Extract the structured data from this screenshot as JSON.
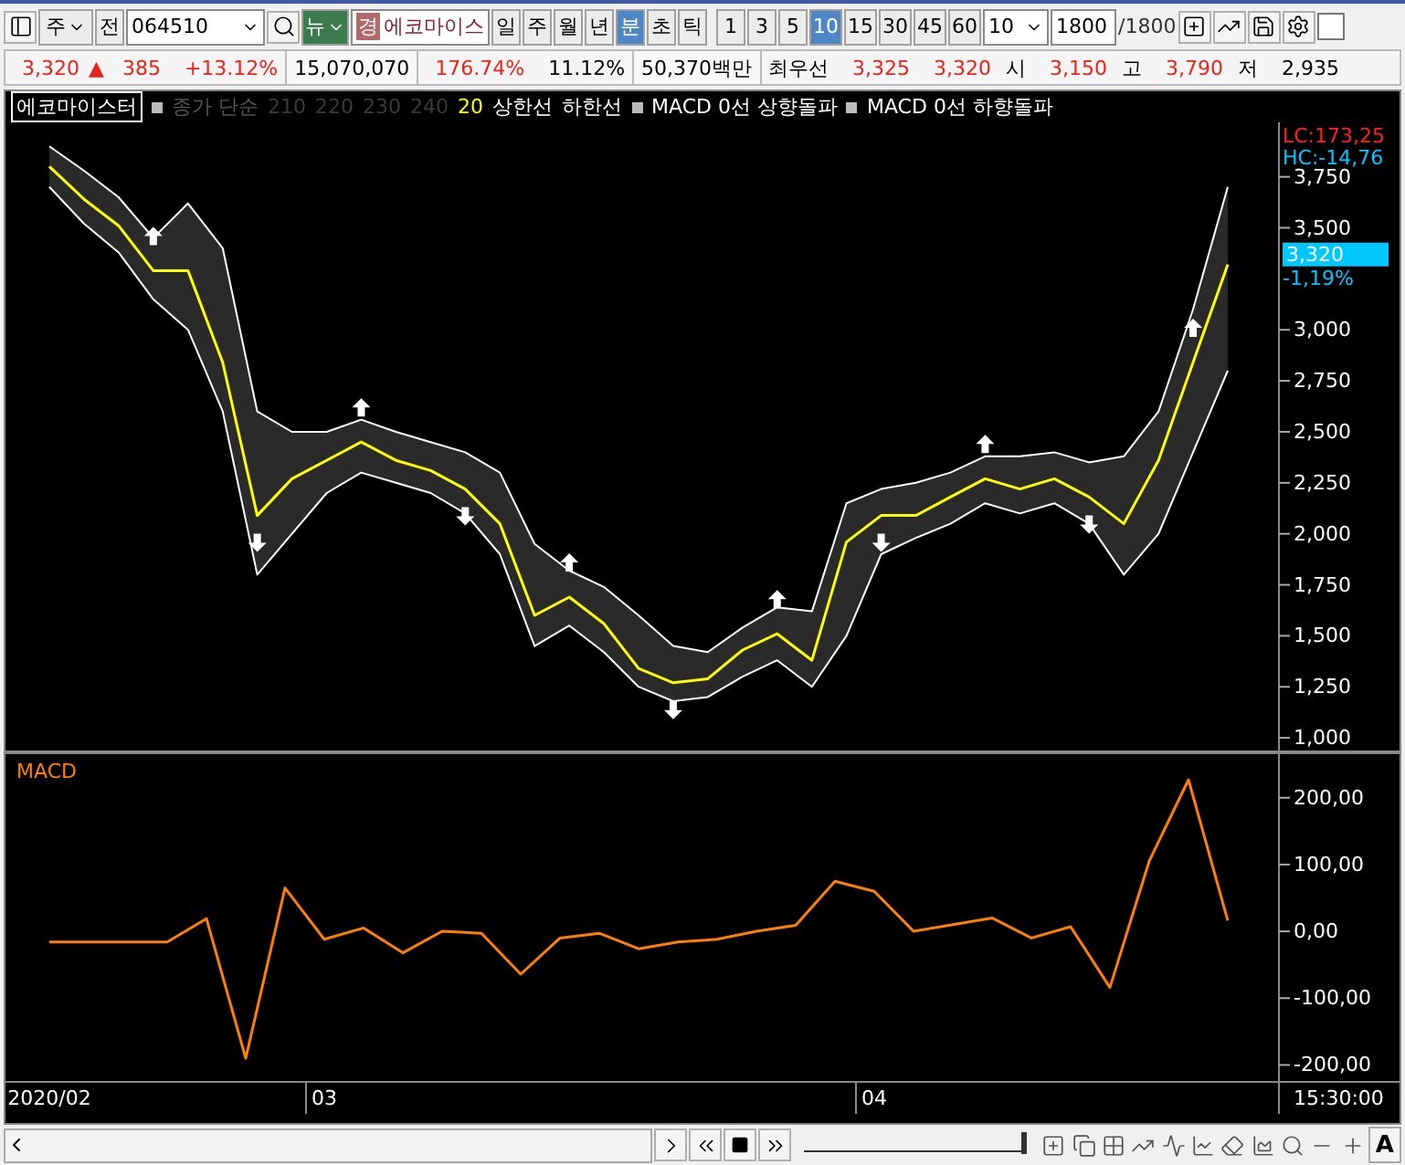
{
  "toolbar": {
    "market": "주",
    "prev": "전",
    "code": "064510",
    "news": "뉴",
    "name_badge": "경",
    "name": "에코마이스",
    "periods": [
      {
        "label": "일",
        "selected": false
      },
      {
        "label": "주",
        "selected": false
      },
      {
        "label": "월",
        "selected": false
      },
      {
        "label": "년",
        "selected": false
      },
      {
        "label": "분",
        "selected": true
      },
      {
        "label": "초",
        "selected": false
      },
      {
        "label": "틱",
        "selected": false
      }
    ],
    "minutes": [
      {
        "label": "1",
        "selected": false
      },
      {
        "label": "3",
        "selected": false
      },
      {
        "label": "5",
        "selected": false
      },
      {
        "label": "10",
        "selected": true
      },
      {
        "label": "15",
        "selected": false
      },
      {
        "label": "30",
        "selected": false
      },
      {
        "label": "45",
        "selected": false
      },
      {
        "label": "60",
        "selected": false
      }
    ],
    "interval": "10",
    "count": "1800",
    "count_total": "/1800",
    "overlay_checked": false
  },
  "quote": {
    "cells": [
      {
        "text": "3,320",
        "color": "#e8231b",
        "kind": "value"
      },
      {
        "text": "▲",
        "color": "#e8231b",
        "kind": "sign"
      },
      {
        "text": "385",
        "color": "#e8231b",
        "kind": "value"
      },
      {
        "text": "+13.12%",
        "color": "#e8231b",
        "kind": "value"
      },
      {
        "text": "15,070,070",
        "color": "#000000",
        "kind": "boxed"
      },
      {
        "text": "176.74%",
        "color": "#e8231b",
        "kind": "value"
      },
      {
        "text": "11.12%",
        "color": "#000000",
        "kind": "value"
      },
      {
        "text": "50,370백만",
        "color": "#000000",
        "kind": "boxed"
      },
      {
        "text": "최우선",
        "color": "#000000",
        "kind": "label"
      },
      {
        "text": "3,325",
        "color": "#e8231b",
        "kind": "value"
      },
      {
        "text": "3,320",
        "color": "#e8231b",
        "kind": "value"
      },
      {
        "text": "시",
        "color": "#000000",
        "kind": "label"
      },
      {
        "text": "3,150",
        "color": "#e8231b",
        "kind": "value"
      },
      {
        "text": "고",
        "color": "#000000",
        "kind": "label"
      },
      {
        "text": "3,790",
        "color": "#e8231b",
        "kind": "value"
      },
      {
        "text": "저",
        "color": "#000000",
        "kind": "label"
      },
      {
        "text": "2,935",
        "color": "#000000",
        "kind": "value"
      }
    ]
  },
  "legend": [
    {
      "text": "에코마이스터",
      "kind": "title"
    },
    {
      "text": "종가 단순",
      "kind": "marker",
      "enabled": false
    },
    {
      "text": "210",
      "kind": "param",
      "color": "#3a3a3a"
    },
    {
      "text": "220",
      "kind": "param",
      "color": "#3a3a3a"
    },
    {
      "text": "230",
      "kind": "param",
      "color": "#3a3a3a"
    },
    {
      "text": "240",
      "kind": "param",
      "color": "#3a3a3a"
    },
    {
      "text": "20",
      "kind": "param",
      "color": "#ffff00"
    }
  ],
  "signals": [
    {
      "text": "MACD 0선 상향돌파",
      "enabled": true
    },
    {
      "text": "MACD 0선 하향돌파",
      "enabled": true
    }
  ],
  "price_pane": {
    "lc": "LC:173,25",
    "hc": "HC:-14,76",
    "last_price": "3,320",
    "last_change": "-1,19%",
    "chart_data": {
      "type": "line",
      "ylim": [
        929,
        4017
      ],
      "categories": [
        null,
        null,
        null,
        null,
        null,
        null,
        null,
        null,
        null,
        null,
        null,
        null,
        null,
        null,
        null,
        null,
        null,
        null,
        null,
        null,
        null,
        null,
        null,
        null,
        null,
        null,
        null,
        null,
        null,
        null,
        null,
        null,
        null,
        null,
        null
      ],
      "yticks": [
        {
          "value": 3750,
          "label": "3,750"
        },
        {
          "value": 3500,
          "label": "3,500"
        },
        {
          "value": 3000,
          "label": "3,000"
        },
        {
          "value": 2750,
          "label": "2,750"
        },
        {
          "value": 2500,
          "label": "2,500"
        },
        {
          "value": 2250,
          "label": "2,250"
        },
        {
          "value": 2000,
          "label": "2,000"
        },
        {
          "value": 1750,
          "label": "1,750"
        },
        {
          "value": 1500,
          "label": "1,500"
        },
        {
          "value": 1250,
          "label": "1,250"
        },
        {
          "value": 1000,
          "label": "1,000"
        }
      ],
      "series": [
        {
          "color": "#ffff00",
          "values": [
            3800,
            3640,
            3510,
            3290,
            3290,
            2840,
            2090,
            2270,
            2360,
            2450,
            2360,
            2310,
            2220,
            2050,
            1600,
            1690,
            1560,
            1340,
            1270,
            1290,
            1430,
            1510,
            1380,
            1960,
            2090,
            2090,
            2180,
            2270,
            2220,
            2270,
            2180,
            2050,
            2360,
            2840,
            3320
          ]
        },
        {
          "name": "상한선",
          "color": "#ffffff",
          "values": [
            3900,
            3780,
            3650,
            3450,
            3620,
            3400,
            2600,
            2500,
            2500,
            2560,
            2500,
            2450,
            2400,
            2300,
            1950,
            1820,
            1740,
            1600,
            1450,
            1420,
            1540,
            1640,
            1620,
            2150,
            2220,
            2250,
            2300,
            2380,
            2380,
            2400,
            2350,
            2380,
            2600,
            3100,
            3700
          ]
        },
        {
          "name": "하한선",
          "color": "#ffffff",
          "values": [
            3700,
            3520,
            3380,
            3150,
            3000,
            2600,
            1800,
            2000,
            2200,
            2300,
            2250,
            2200,
            2100,
            1900,
            1450,
            1550,
            1420,
            1250,
            1180,
            1200,
            1300,
            1380,
            1250,
            1500,
            1900,
            1980,
            2050,
            2150,
            2100,
            2150,
            2050,
            1800,
            2000,
            2400,
            2800
          ]
        }
      ]
    }
  },
  "macd_pane": {
    "chart_data": {
      "type": "line",
      "ylim": [
        -224,
        268
      ],
      "categories": [
        "2020/02",
        null,
        null,
        null,
        null,
        null,
        null,
        "03",
        null,
        null,
        null,
        null,
        null,
        null,
        null,
        null,
        null,
        null,
        null,
        null,
        null,
        "04",
        null,
        null,
        null,
        null,
        null,
        null,
        null,
        null,
        null
      ],
      "yticks": [
        {
          "value": 200,
          "label": "200,00"
        },
        {
          "value": 100,
          "label": "100,00"
        },
        {
          "value": 0,
          "label": "0,00"
        },
        {
          "value": -100,
          "label": "-100,00"
        },
        {
          "value": -200,
          "label": "-200,00"
        }
      ],
      "series": [
        {
          "name": "MACD",
          "color": "#ff7f00",
          "values": [
            -16,
            -16,
            -16,
            -16,
            19,
            -190,
            65,
            -12,
            5,
            -32,
            0,
            -3,
            -64,
            -10,
            -3,
            -26,
            -16,
            -12,
            0,
            9,
            75,
            60,
            0,
            10,
            20,
            -10,
            7,
            -84,
            105,
            227,
            16
          ]
        }
      ]
    }
  },
  "time": "15:30:00",
  "footer": {
    "zoom": {
      "level": 1
    },
    "font_button": "A"
  }
}
